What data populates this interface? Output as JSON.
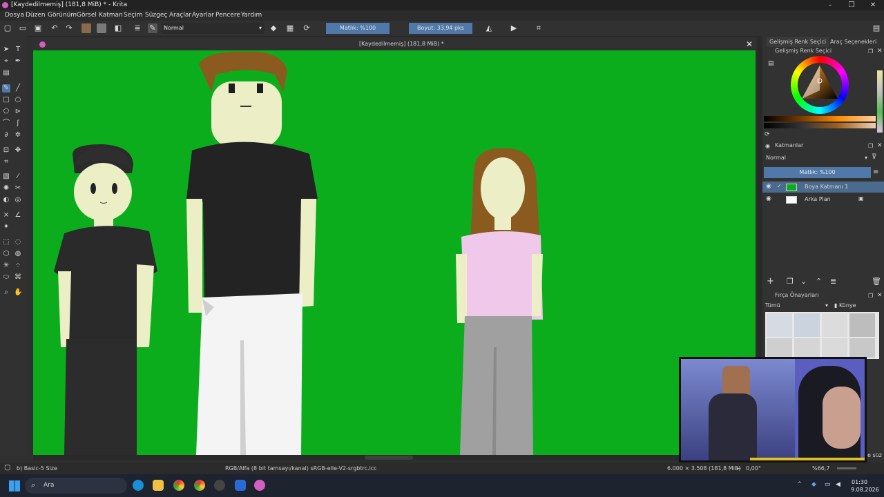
{
  "window": {
    "title": "[Kaydedilmemiş]  (181,8 MiB) * - Krita"
  },
  "menu": [
    "Dosya",
    "Düzen",
    "Görünüm",
    "Görsel",
    "Katman",
    "Seçim",
    "Süzgeç",
    "Araçlar",
    "Ayarlar",
    "Pencere",
    "Yardım"
  ],
  "toolbar": {
    "blend_mode": "Normal",
    "opacity": "Matlık: %100",
    "size": "Boyut: 33,94 pks"
  },
  "document": {
    "tab_title": "[Kaydedilmemiş]  (181,8 MiB) *"
  },
  "right_panel": {
    "tabs": [
      "Gelişmiş Renk Seçici",
      "Araç Seçenekleri"
    ],
    "color_selector_title": "Gelişmiş Renk Seçici",
    "layers_title": "Katmanlar",
    "layers_blend": "Normal",
    "layers_opacity": "Matlık: %100",
    "layers": [
      {
        "name": "Boya Katmanı 1"
      },
      {
        "name": "Arka Plan"
      }
    ],
    "brush_presets_title": "Fırça Önayarları",
    "brush_filter": "Tümü",
    "brush_tag": "Künye",
    "brush_search_label": "e süz"
  },
  "status": {
    "brush": "b) Basic-5 Size",
    "color_space": "RGB/Alfa (8 bit tamsayı/kanal)  sRGB-elle-V2-srgbtrc.icc",
    "image_size": "6.000 × 3.508 (181,8 MiB)",
    "rotation": "0,00°",
    "zoom": "%66,7"
  },
  "taskbar": {
    "search": "Ara",
    "time": "01:30",
    "date": "9.08.2026"
  },
  "colors": {
    "canvas_bg": "#0cad1d",
    "accent": "#5078a8"
  }
}
